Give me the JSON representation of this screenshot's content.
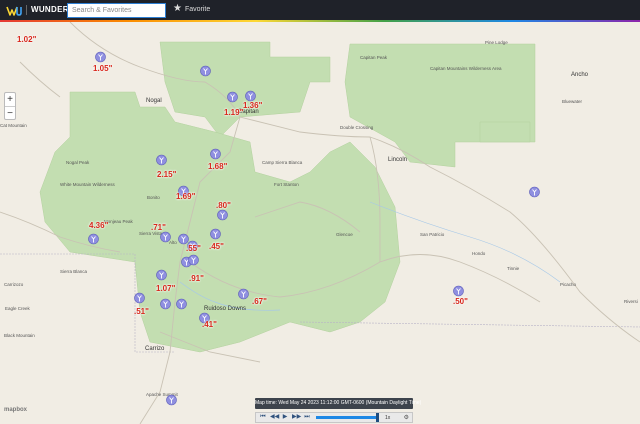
{
  "header": {
    "brand": "WUNDERMAP",
    "search_placeholder": "Search & Favorites",
    "favorite_label": "Favorite"
  },
  "map": {
    "zoom_in": "+",
    "zoom_out": "−",
    "attribution": "mapbox",
    "place_names": {
      "nogal": "Nogal",
      "capitan": "Capitan",
      "lincoln": "Lincoln",
      "ruidoso_downs": "Ruidoso Downs",
      "carrizo": "Carrizo",
      "pine_lodge": "Pine Lodge",
      "ancho": "Ancho",
      "bluewater": "Bluewater",
      "capitan_peak": "Capitan Peak",
      "capitan_mtns": "Capitan Mountains Wilderness Area",
      "nogal_peak": "Nogal Peak",
      "white_mountain": "White Mountain Wilderness",
      "sierra_blanca": "Sierra Blanca",
      "monjeau_peak": "Monjeau Peak",
      "bonito": "Bonito",
      "sierra_vista": "Sierra Vista",
      "alto": "Alto",
      "san_patricio": "San Patricio",
      "hondo": "Hondo",
      "tinnie": "Tinnie",
      "picacho": "Picacho",
      "riverside": "Riversi",
      "glencoe": "Glencoe",
      "fort_stanton": "Fort Stanton",
      "camp_sierra_blanca": "Camp Sierra Blanca",
      "double_crossing": "Double Crossing",
      "cat_mountain": "Cat Mountain",
      "black_mountain": "Black Mountain",
      "eagle_creek": "Eagle Creek",
      "carrizozo": "Carrizozo",
      "apache": "Apache Summit"
    },
    "precip_values": [
      "1.02\"",
      "1.05\"",
      "1.36\"",
      "1.19\"",
      "1.68\"",
      "2.15\"",
      "1.69\"",
      ".80\"",
      "4.36\"",
      ".71\"",
      ".55\"",
      ".45\"",
      ".91\"",
      "1.07\"",
      ".51\"",
      ".67\"",
      ".41\"",
      ".50\""
    ]
  },
  "timeline": {
    "label": "Map time: Wed May 24 2023 11:12:00 GMT-0600 (Mountain Daylight Time)",
    "speed": "1x",
    "controls": {
      "first": "⏮",
      "back": "◀◀",
      "play": "▶",
      "forward": "▶▶",
      "last": "⏭",
      "settings": "⚙"
    }
  },
  "colors": {
    "forest": "#c3deb1",
    "land": "#f1ede4",
    "precip_text": "#d8271c",
    "station": "#8f8fe0",
    "topbar": "#1f2229"
  }
}
